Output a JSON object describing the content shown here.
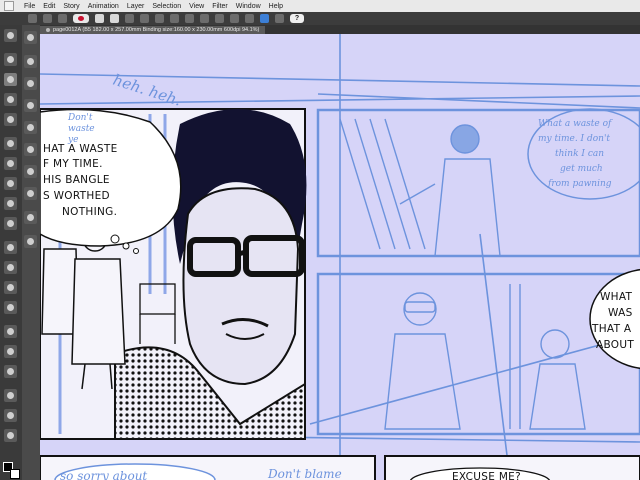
{
  "menu": {
    "items": [
      "File",
      "Edit",
      "Story",
      "Animation",
      "Layer",
      "Selection",
      "View",
      "Filter",
      "Window",
      "Help"
    ]
  },
  "tab": {
    "title": "page0012A (B5 182.00 x 257.00mm Binding size:160.00 x 230.00mm 600dpi 94.1%)"
  },
  "colors": {
    "canvas": "#d6d4f8",
    "sketch_blue": "#6d93dd",
    "ink": "#111111"
  },
  "canvas": {
    "scribble_top": "heh. heh.",
    "bubble_main": {
      "lines": [
        "HAT A WASTE",
        "F MY TIME.",
        "HIS BANGLE",
        "S WORTHED",
        "NOTHING."
      ]
    },
    "sketch_bubble_left": {
      "lines": [
        "Don't",
        "waste",
        "ye"
      ]
    },
    "sketch_bubble_right": {
      "lines": [
        "What a waste of",
        "my time. I don't",
        "think I can",
        "get much",
        "from pawning"
      ]
    },
    "bubble_right_edge": {
      "lines": [
        "WHAT",
        "WAS",
        "THAT A",
        "ABOUT"
      ]
    },
    "bottom_left_text": "so sorry about",
    "bottom_mid_text": "Don't blame",
    "bottom_right_text": "EXCUSE ME?"
  }
}
